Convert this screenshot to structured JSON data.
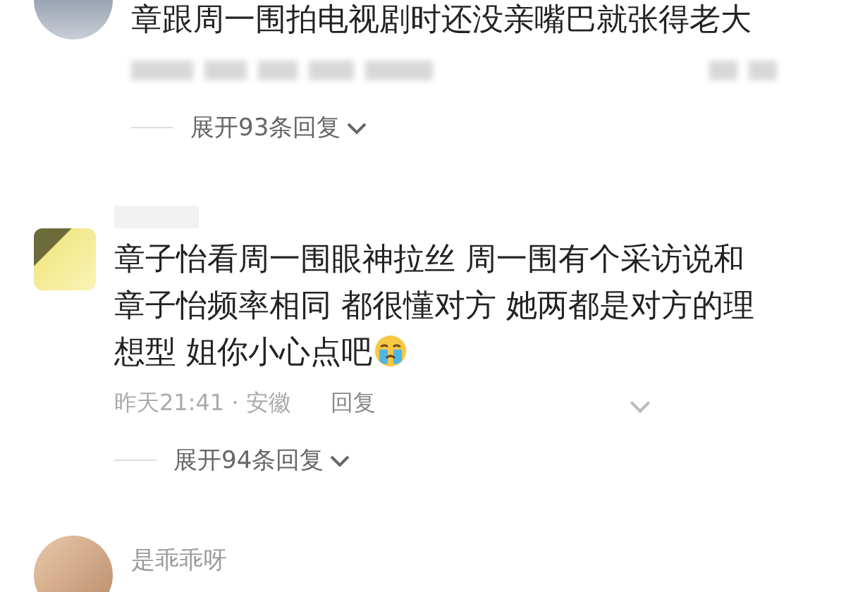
{
  "comments": [
    {
      "kind": "circle",
      "text": "章跟周一围拍电视剧时还没亲嘴巴就张得老大",
      "meta_redacted": true,
      "expand": "展开93条回复"
    },
    {
      "kind": "blurred",
      "text": "章子怡看周一围眼神拉丝 周一围有个采访说和章子怡频率相同 都很懂对方 她两都是对方的理想型 姐你小心点吧",
      "crying_emoji": true,
      "time": "昨天21:41 · 安徽",
      "reply_label": "回复",
      "expand": "展开94条回复"
    },
    {
      "kind": "photo",
      "username": "是乖乖呀"
    }
  ]
}
